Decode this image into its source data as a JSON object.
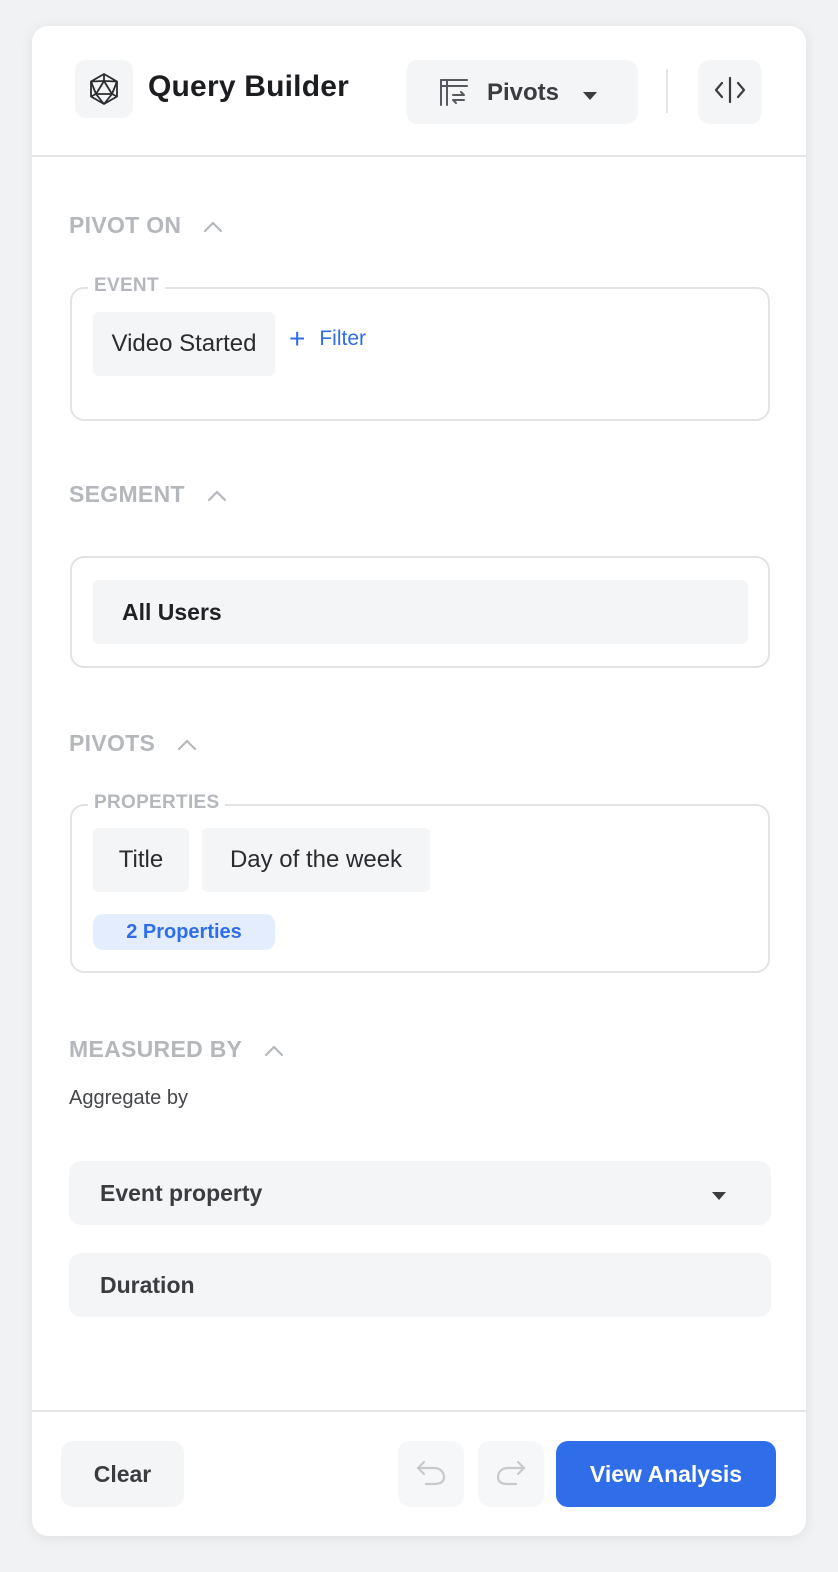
{
  "header": {
    "title": "Query Builder",
    "view_select": {
      "selected": "Pivots"
    }
  },
  "sections": {
    "pivot_on": {
      "title": "PIVOT ON",
      "legend": "EVENT",
      "event": "Video Started",
      "filter_label": "Filter"
    },
    "segment": {
      "title": "SEGMENT",
      "value": "All Users"
    },
    "pivots": {
      "title": "PIVOTS",
      "legend": "PROPERTIES",
      "properties": [
        "Title",
        "Day of the week"
      ],
      "count_label": "2 Properties"
    },
    "measured_by": {
      "title": "MEASURED BY",
      "aggregate_label": "Aggregate by",
      "aggregate_value": "Event property",
      "property_value": "Duration"
    }
  },
  "footer": {
    "clear_label": "Clear",
    "primary_label": "View Analysis"
  },
  "colors": {
    "accent": "#2f6ee8",
    "pill_bg": "#e4edfd",
    "muted_text": "#b4b7bc",
    "surface": "#f4f5f7"
  },
  "icons": {
    "logo": "icosahedron-icon",
    "view": "pivot-table-icon",
    "code": "code-toggle-icon",
    "undo": "undo-icon",
    "redo": "redo-icon"
  }
}
